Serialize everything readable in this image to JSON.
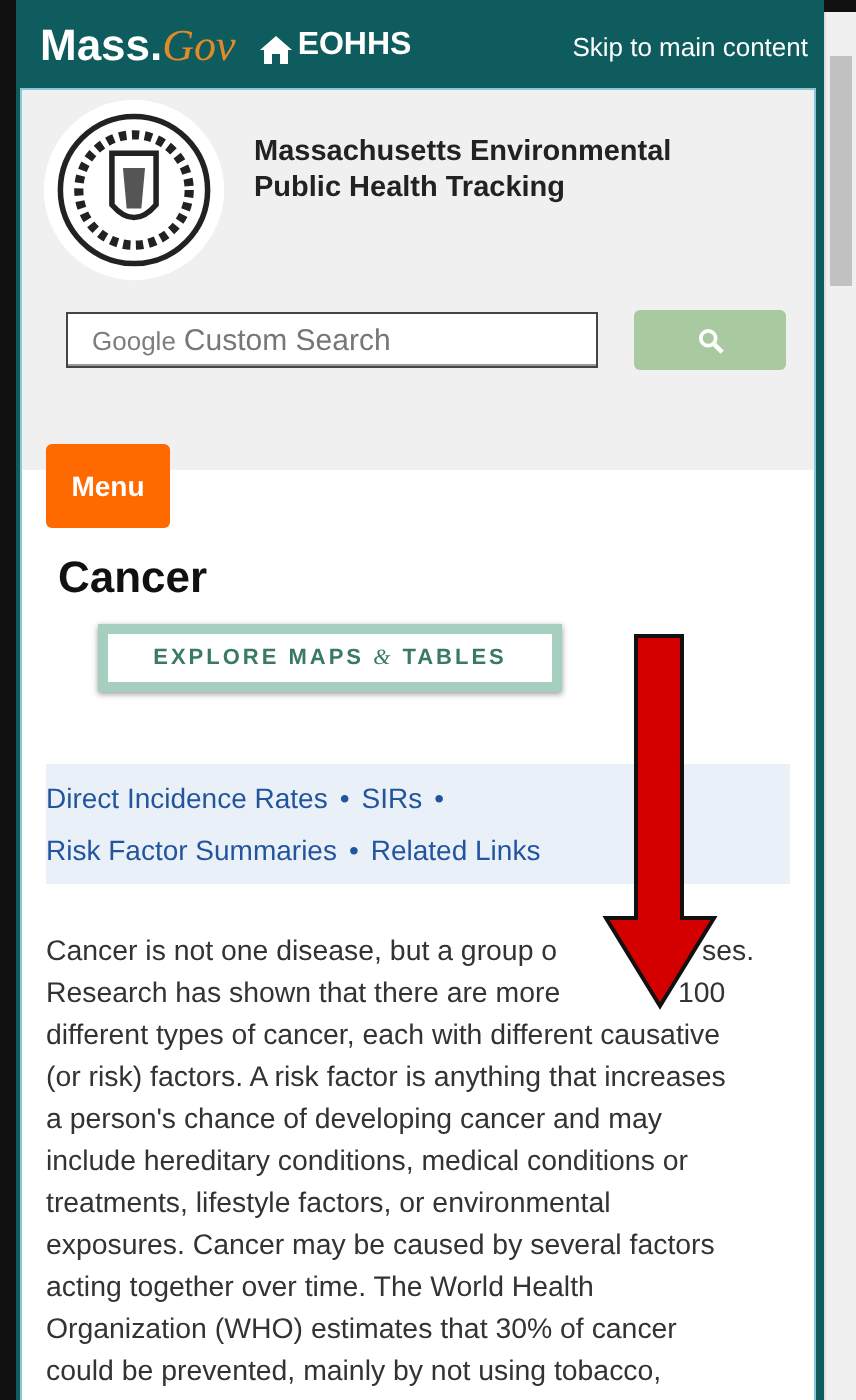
{
  "header": {
    "logo_main": "Mass.",
    "logo_script": "Gov",
    "home_link": "EOHHS",
    "skip_link": "Skip to main content"
  },
  "site": {
    "title_lines": [
      "Massachusetts Environmental",
      "Public Health Tracking"
    ]
  },
  "search": {
    "brand": "Google",
    "placeholder": "Custom Search"
  },
  "menu_button": "Menu",
  "page_title": "Cancer",
  "explore_button": {
    "before": "EXPLORE MAPS",
    "amp": "&",
    "after": "TABLES"
  },
  "links": [
    {
      "label": "Direct Incidence Rates",
      "separator": "•"
    },
    {
      "label": "SIRs",
      "separator": "•"
    },
    {
      "label": "Risk Factor Summaries",
      "separator": "•"
    },
    {
      "label": "Related Links"
    }
  ],
  "covered_lines": [
    [
      "Cancer is not one disease, but a group o",
      "ses."
    ],
    [
      "Research has shown that there are more",
      "100"
    ]
  ],
  "paragraph_lines": [
    "different types of cancer, each with different causative",
    "(or risk) factors. A risk factor is anything that increases",
    "a person's chance of developing cancer and may",
    "include hereditary conditions, medical conditions or",
    "treatments, lifestyle factors, or environmental",
    "exposures. Cancer may be caused by several factors",
    "acting together over time. The World Health",
    "Organization (WHO) estimates that 30% of cancer",
    "could be prevented, mainly by not using tobacco,"
  ],
  "annotation": {
    "kind": "arrow"
  }
}
